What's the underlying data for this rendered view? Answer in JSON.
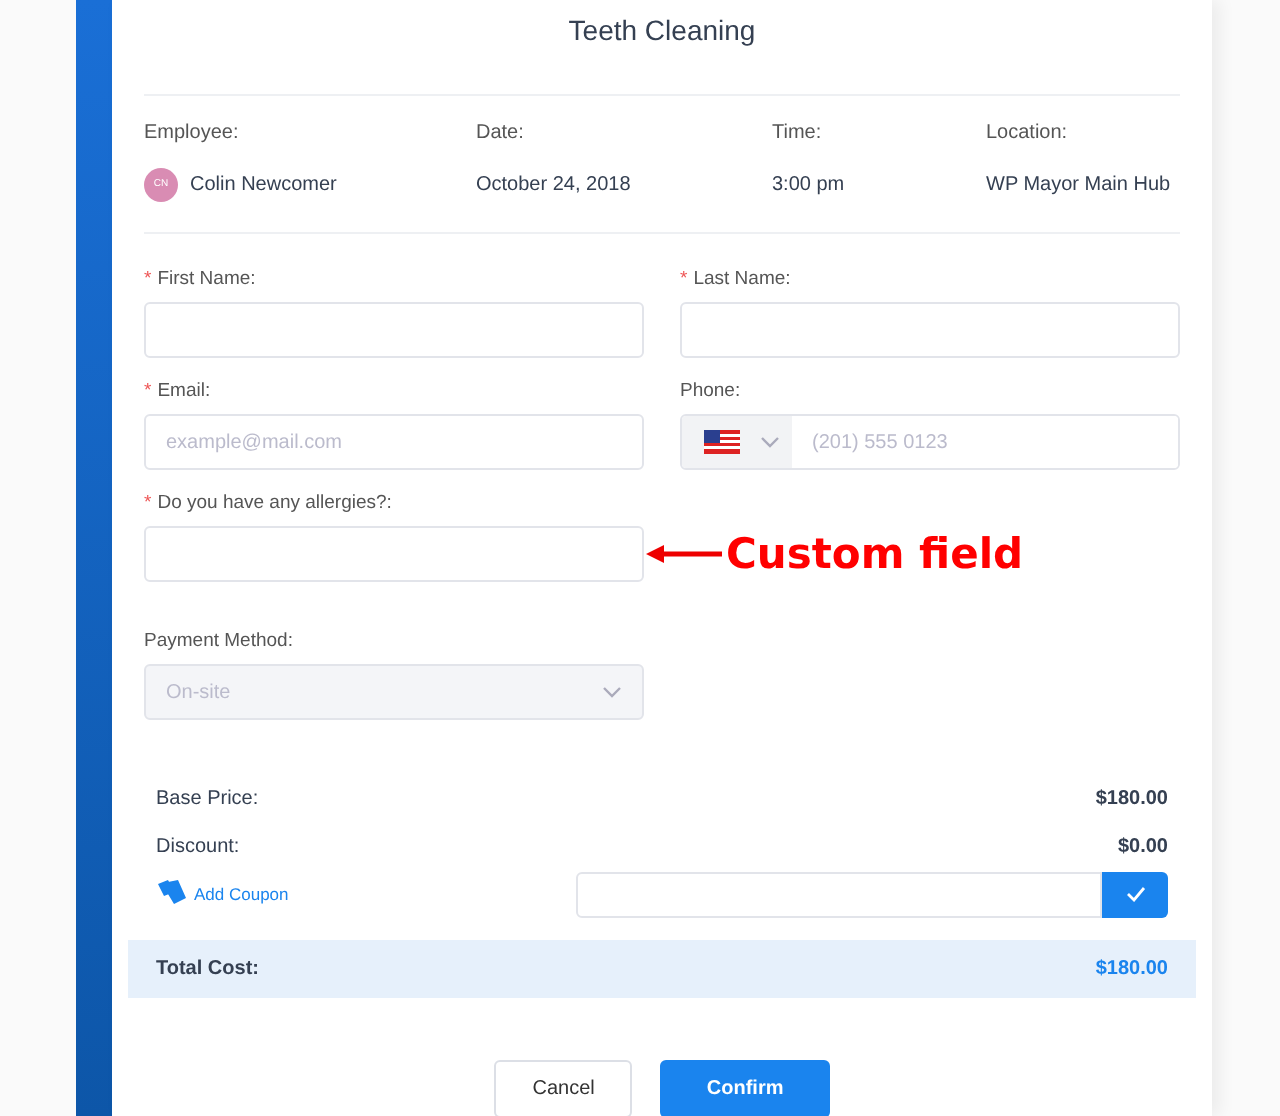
{
  "title": "Teeth Cleaning",
  "details": [
    {
      "label": "Employee:",
      "value": "Colin Newcomer",
      "avatar": "CN"
    },
    {
      "label": "Date:",
      "value": "October 24, 2018"
    },
    {
      "label": "Time:",
      "value": "3:00 pm"
    },
    {
      "label": "Location:",
      "value": "WP Mayor Main Hub"
    }
  ],
  "fields": [
    {
      "kind": "text",
      "label": "First Name:",
      "required_mark": "*"
    },
    {
      "kind": "text",
      "label": "Last Name:",
      "required_mark": "*"
    },
    {
      "kind": "text",
      "label": "Email:",
      "required_mark": "*",
      "placeholder": "example@mail.com"
    },
    {
      "kind": "phone",
      "label": "Phone:",
      "placeholder": "(201) 555 0123"
    },
    {
      "kind": "text",
      "label": "Do you have any allergies?:",
      "required_mark": "*",
      "annotation": "Custom field"
    },
    {
      "kind": "select",
      "label": "Payment Method:",
      "value": "On-site",
      "disabled": true
    }
  ],
  "prices": [
    {
      "label": "Base Price:",
      "value": "$180.00"
    },
    {
      "label": "Discount:",
      "value": "$0.00"
    }
  ],
  "coupon": {
    "label": "Add Coupon"
  },
  "total": {
    "label": "Total Cost:",
    "value": "$180.00"
  },
  "buttons": [
    {
      "label": "Cancel",
      "kind": "secondary"
    },
    {
      "label": "Confirm",
      "kind": "primary"
    }
  ]
}
